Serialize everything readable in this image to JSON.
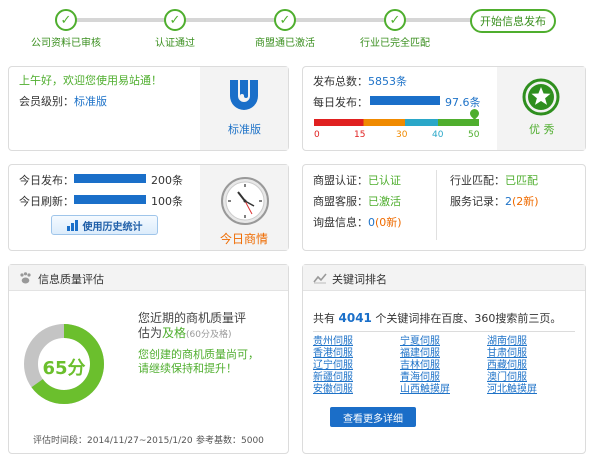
{
  "steps": [
    {
      "label": "公司资料已审核",
      "check": "✓"
    },
    {
      "label": "认证通过",
      "check": "✓"
    },
    {
      "label": "商盟通已激活",
      "check": "✓"
    },
    {
      "label": "行业已完全匹配",
      "check": "✓"
    }
  ],
  "step_current": "开始信息发布",
  "welcome": {
    "greeting": "上午好，欢迎您使用易站通！",
    "level_label": "会员级别：",
    "level_value": "标准版",
    "badge_label": "标准版"
  },
  "publish": {
    "total_label": "发布总数：",
    "total_value": "5853条",
    "daily_label": "每日发布：",
    "daily_value": "97.6条",
    "daily_fraction": 0.976,
    "scale": [
      "0",
      "15",
      "30",
      "40",
      "50"
    ],
    "rating": "优 秀"
  },
  "today": {
    "publish_label": "今日发布：",
    "publish_value": "200条",
    "refresh_label": "今日刷新：",
    "refresh_value": "100条",
    "history_button": "使用历史统计",
    "clock_caption": "今日商情"
  },
  "status": {
    "cert_label": "商盟认证：",
    "cert_value": "已认证",
    "match_label": "行业匹配：",
    "match_value": "已匹配",
    "cs_label": "商盟客服：",
    "cs_value": "已激活",
    "service_label": "服务记录：",
    "service_value": "2",
    "service_new": "(2新)",
    "inquiry_label": "询盘信息：",
    "inquiry_value": "0",
    "inquiry_new": "(0新)"
  },
  "quality": {
    "title": "信息质量评估",
    "score": "65分",
    "score_fraction": 0.65,
    "desc_line1": "您近期的商机质量评",
    "desc_line2": "估为",
    "grade": "及格",
    "grade_note": "(60分及格)",
    "advice_line1": "您创建的商机质量尚可，",
    "advice_line2": "请继续保持和提升！",
    "period": "评估时间段：2014/11/27~2015/1/20",
    "base": "参考基数：5000"
  },
  "keywords": {
    "title": "关键词排名",
    "summary_pre": "共有",
    "count": "4041",
    "summary_post": "个关键词排在百度、360搜索前三页。",
    "items": [
      "贵州伺服",
      "宁夏伺服",
      "湖南伺服",
      "香港伺服",
      "福建伺服",
      "甘肃伺服",
      "辽宁伺服",
      "吉林伺服",
      "西藏伺服",
      "新疆伺服",
      "青海伺服",
      "澳门伺服",
      "安徽伺服",
      "山西触摸屏",
      "河北触摸屏"
    ],
    "more_button": "查看更多详细"
  },
  "colors": {
    "accent_green": "#4fae2e",
    "accent_blue": "#1a6fc9",
    "accent_orange": "#ef6b00"
  }
}
